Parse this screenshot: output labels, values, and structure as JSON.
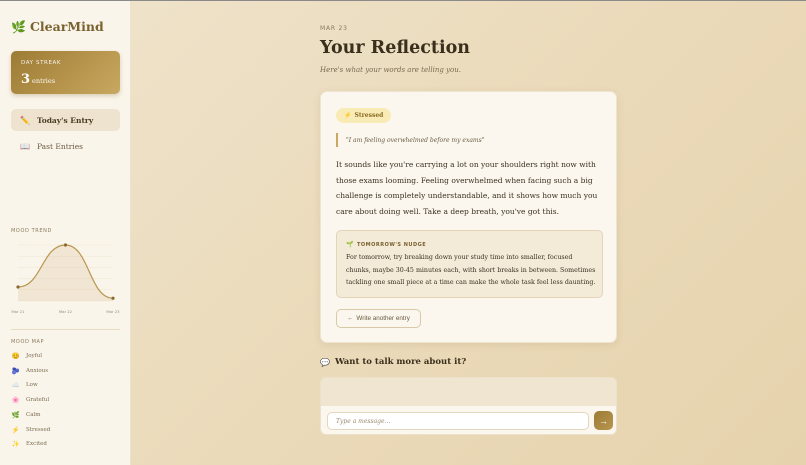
{
  "app": {
    "name": "ClearMind",
    "logo_icon": "leaf-icon"
  },
  "streak": {
    "label": "DAY STREAK",
    "count": "3",
    "unit": "entries"
  },
  "nav": [
    {
      "label": "Today's Entry",
      "icon": "pencil-icon",
      "glyph": "✏️",
      "active": true
    },
    {
      "label": "Past Entries",
      "icon": "book-icon",
      "glyph": "📖",
      "active": false
    }
  ],
  "mood_trend": {
    "label": "MOOD TREND",
    "chart_data": {
      "type": "area",
      "x": [
        "Mar 21",
        "Mar 22",
        "Mar 23"
      ],
      "values": [
        0.25,
        1.0,
        0.05
      ],
      "ylim": [
        0,
        1
      ]
    }
  },
  "mood_map": {
    "label": "MOOD MAP",
    "items": [
      {
        "label": "Joyful",
        "glyph": "😊",
        "icon": "joyful-icon"
      },
      {
        "label": "Anxious",
        "glyph": "🫐",
        "icon": "anxious-icon"
      },
      {
        "label": "Low",
        "glyph": "☁️",
        "icon": "low-icon"
      },
      {
        "label": "Grateful",
        "glyph": "🌸",
        "icon": "grateful-icon"
      },
      {
        "label": "Calm",
        "glyph": "🌿",
        "icon": "calm-icon"
      },
      {
        "label": "Stressed",
        "glyph": "⚡",
        "icon": "stressed-icon"
      },
      {
        "label": "Excited",
        "glyph": "✨",
        "icon": "excited-icon"
      }
    ]
  },
  "main": {
    "date": "MAR 23",
    "title": "Your Reflection",
    "subtitle": "Here's what your words are telling you."
  },
  "reflection": {
    "mood_badge": "Stressed",
    "mood_icon": "⚡",
    "quote": "\"I am feeling overwhelmed before my exams\"",
    "body": "It sounds like you're carrying a lot on your shoulders right now with those exams looming. Feeling overwhelmed when facing such a big challenge is completely understandable, and it shows how much you care about doing well. Take a deep breath, you've got this.",
    "nudge_label": "TOMORROW'S NUDGE",
    "nudge_icon": "🌱",
    "nudge_text": "For tomorrow, try breaking down your study time into smaller, focused chunks, maybe 30-45 minutes each, with short breaks in between. Sometimes tackling one small piece at a time can make the whole task feel less daunting.",
    "write_another": "Write another entry",
    "write_another_arrow": "←"
  },
  "chat": {
    "heading": "Want to talk more about it?",
    "heading_icon": "💬",
    "placeholder": "Type a message...",
    "send_glyph": "→"
  },
  "colors": {
    "accent": "#b0904a",
    "line": "#b8964e",
    "background": "#efe4cc"
  }
}
